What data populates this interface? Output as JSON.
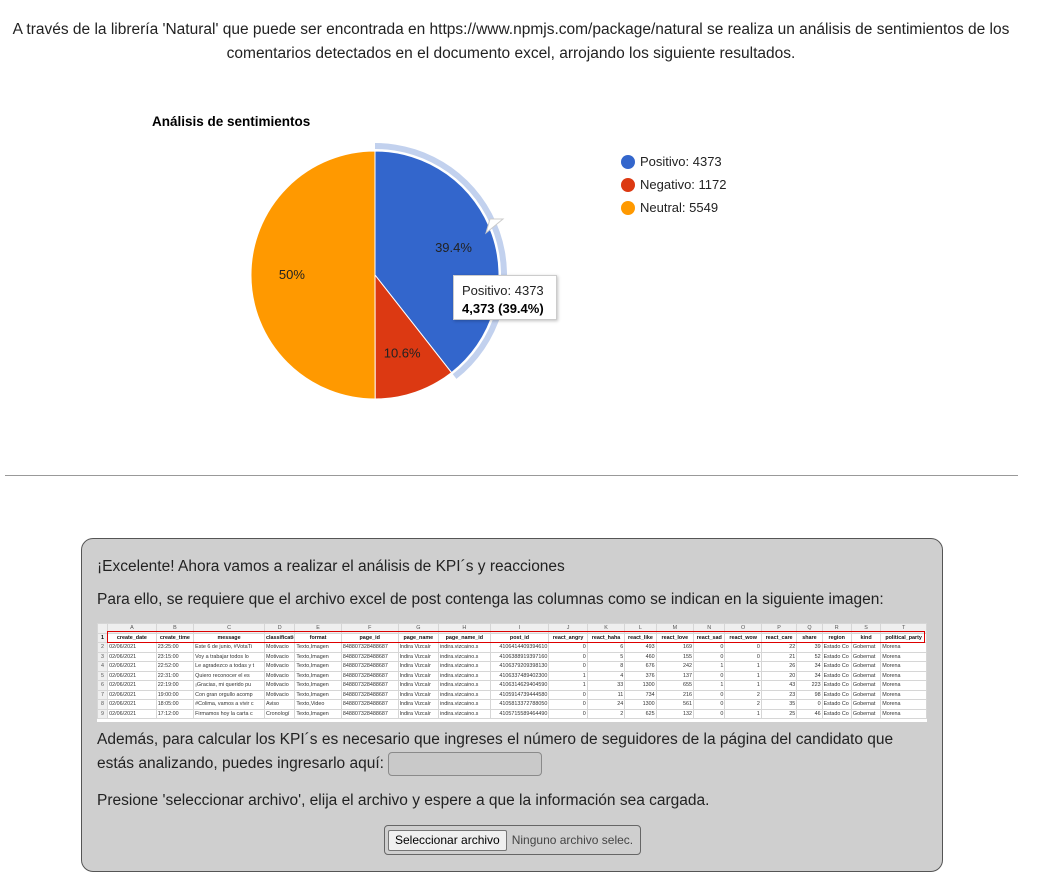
{
  "intro_text": "A través de la librería 'Natural' que puede ser encontrada en https://www.npmjs.com/package/natural se realiza un análisis de sentimientos de los comentarios detectados en el documento excel, arrojando los siguiente resultados.",
  "chart_data": {
    "type": "pie",
    "title": "Análisis de sentimientos",
    "categories": [
      "Positivo",
      "Negativo",
      "Neutral"
    ],
    "values": [
      4373,
      1172,
      5549
    ],
    "colors": [
      "#3366cc",
      "#dc3912",
      "#ff9900"
    ],
    "slice_labels": [
      "39.4%",
      "10.6%",
      "50%"
    ],
    "legend_labels": [
      "Positivo: 4373",
      "Negativo: 1172",
      "Neutral: 5549"
    ],
    "legend_position": "right",
    "highlighted": "Positivo",
    "tooltip": {
      "line1": "Positivo: 4373",
      "line2": "4,373 (39.4%)"
    }
  },
  "panel": {
    "excellent_text": "¡Excelente! Ahora vamos a realizar el análisis de KPI´s y reacciones",
    "requirement_text": "Para ello, se requiere que el archivo excel de post contenga las columnas como se indican en la siguiente imagen:",
    "followers_text": "Además, para calcular los KPI´s es necesario que ingreses el número de seguidores de la página del candidato que estás analizando, puedes ingresarlo aquí:",
    "followers_value": "",
    "select_text": "Presione 'seleccionar archivo', elija el archivo y espere a que la información sea cargada.",
    "file_button": "Seleccionar archivo",
    "file_status": "Ninguno archivo selec."
  },
  "spreadsheet": {
    "col_letters": [
      "A",
      "B",
      "C",
      "D",
      "E",
      "F",
      "G",
      "H",
      "I",
      "J",
      "K",
      "L",
      "M",
      "N",
      "O",
      "P",
      "Q",
      "R",
      "S",
      "T"
    ],
    "headers": [
      "create_date",
      "create_time",
      "message",
      "classificatio",
      "format",
      "page_id",
      "page_name",
      "page_name_id",
      "post_id",
      "react_angry",
      "react_haha",
      "react_like",
      "react_love",
      "react_sad",
      "react_wow",
      "react_care",
      "share",
      "region",
      "kind",
      "political_party"
    ],
    "rows": [
      [
        "02/06/2021",
        "23:25:00",
        "Este 6 de junio, #VotaTi",
        "Motivacio",
        "Texto,Imagen",
        "848807328488687",
        "Indira Vizcaír",
        "indira.vizcaino.s",
        "4106414409394610",
        "0",
        "6",
        "493",
        "169",
        "0",
        "0",
        "22",
        "39",
        "Estado Co",
        "Gobernat",
        "Morena"
      ],
      [
        "02/06/2021",
        "23:15:00",
        "Voy a trabajar todos lo",
        "Motivacio",
        "Texto,Imagen",
        "848807328488687",
        "Indira Vizcaír",
        "indira.vizcaino.s",
        "4106388919397160",
        "0",
        "5",
        "460",
        "155",
        "0",
        "0",
        "21",
        "52",
        "Estado Co",
        "Gobernat",
        "Morena"
      ],
      [
        "02/06/2021",
        "22:52:00",
        "Le agradezco a todas y t",
        "Motivacio",
        "Texto,Imagen",
        "848807328488687",
        "Indira Vizcaír",
        "indira.vizcaino.s",
        "4106379209398130",
        "0",
        "8",
        "676",
        "242",
        "1",
        "1",
        "26",
        "34",
        "Estado Co",
        "Gobernat",
        "Morena"
      ],
      [
        "02/06/2021",
        "22:31:00",
        "Quiero reconocer el es",
        "Motivacio",
        "Texto,Imagen",
        "848807328488687",
        "Indira Vizcaír",
        "indira.vizcaino.s",
        "4106337489402300",
        "1",
        "4",
        "376",
        "137",
        "0",
        "1",
        "20",
        "34",
        "Estado Co",
        "Gobernat",
        "Morena"
      ],
      [
        "02/06/2021",
        "22:19:00",
        "¡Gracias, mi querido pu",
        "Motivacio",
        "Texto,Imagen",
        "848807328488687",
        "Indira Vizcaír",
        "indira.vizcaino.s",
        "4106314629404590",
        "1",
        "33",
        "1300",
        "655",
        "1",
        "1",
        "43",
        "223",
        "Estado Co",
        "Gobernat",
        "Morena"
      ],
      [
        "02/06/2021",
        "19:00:00",
        "Con gran orgullo acomp",
        "Motivacio",
        "Texto,Imagen",
        "848807328488687",
        "Indira Vizcaír",
        "indira.vizcaino.s",
        "4105914739444580",
        "0",
        "11",
        "734",
        "216",
        "0",
        "2",
        "23",
        "98",
        "Estado Co",
        "Gobernat",
        "Morena"
      ],
      [
        "02/06/2021",
        "18:05:00",
        "#Colima, vamos a vivir c",
        "Aviso",
        "Texto,Video",
        "848807328488687",
        "Indira Vizcaír",
        "indira.vizcaino.s",
        "4105813372788050",
        "0",
        "24",
        "1300",
        "561",
        "0",
        "2",
        "35",
        "0",
        "Estado Co",
        "Gobernat",
        "Morena"
      ],
      [
        "02/06/2021",
        "17:12:00",
        "Firmamos hoy la carta c",
        "Cronologí",
        "Texto,Imagen",
        "848807328488687",
        "Indira Vizcaír",
        "indira.vizcaino.s",
        "4105715589464490",
        "0",
        "2",
        "625",
        "132",
        "0",
        "1",
        "25",
        "46",
        "Estado Co",
        "Gobernat",
        "Morena"
      ]
    ]
  }
}
